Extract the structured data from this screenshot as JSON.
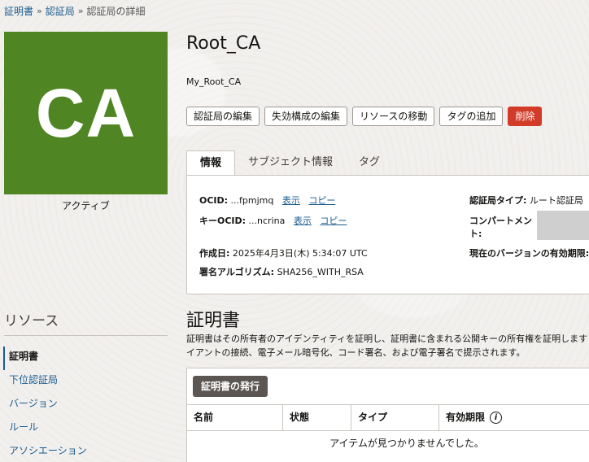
{
  "breadcrumb": {
    "item1": "証明書",
    "item2": "認証局",
    "current": "認証局の詳細",
    "separator": "»"
  },
  "badge": {
    "text": "CA",
    "color": "#4f8523"
  },
  "status": "アクティブ",
  "resources": {
    "title": "リソース",
    "items": [
      "証明書",
      "下位認証局",
      "バージョン",
      "ルール",
      "アソシエーション"
    ]
  },
  "header": {
    "title": "Root_CA",
    "subtitle": "My_Root_CA"
  },
  "actions": {
    "edit": "認証局の編集",
    "edit_revocation": "失効構成の編集",
    "move": "リソースの移動",
    "add_tags": "タグの追加",
    "delete": "削除"
  },
  "tabs": [
    "情報",
    "サブジェクト情報",
    "タグ"
  ],
  "info": {
    "ocid_label": "OCID:",
    "ocid_value": "...fpmjmq",
    "show": "表示",
    "copy": "コピー",
    "key_ocid_label": "キーOCID:",
    "key_ocid_value": "...ncrina",
    "created_label": "作成日:",
    "created_value": "2025年4月3日(木) 5:34:07 UTC",
    "algo_label": "署名アルゴリズム:",
    "algo_value": "SHA256_WITH_RSA",
    "ca_type_label": "認証局タイプ:",
    "ca_type_value": "ルート認証局",
    "compartment_label_1": "コンパートメン",
    "compartment_label_2": "ト:",
    "validity_label": "現在のバージョンの有効期限:"
  },
  "certificates": {
    "title": "証明書",
    "desc_line1": "証明書はその所有者のアイデンティティを証明し、証明書に含まれる公開キーの所有権を証明します",
    "desc_line2": "イアントの接続、電子メール暗号化、コード署名、および電子署名で提示されます。",
    "issue_button": "証明書の発行",
    "columns": [
      "名前",
      "状態",
      "タイプ",
      "有効期限"
    ],
    "empty_text": "アイテムが見つかりませんでした。"
  }
}
